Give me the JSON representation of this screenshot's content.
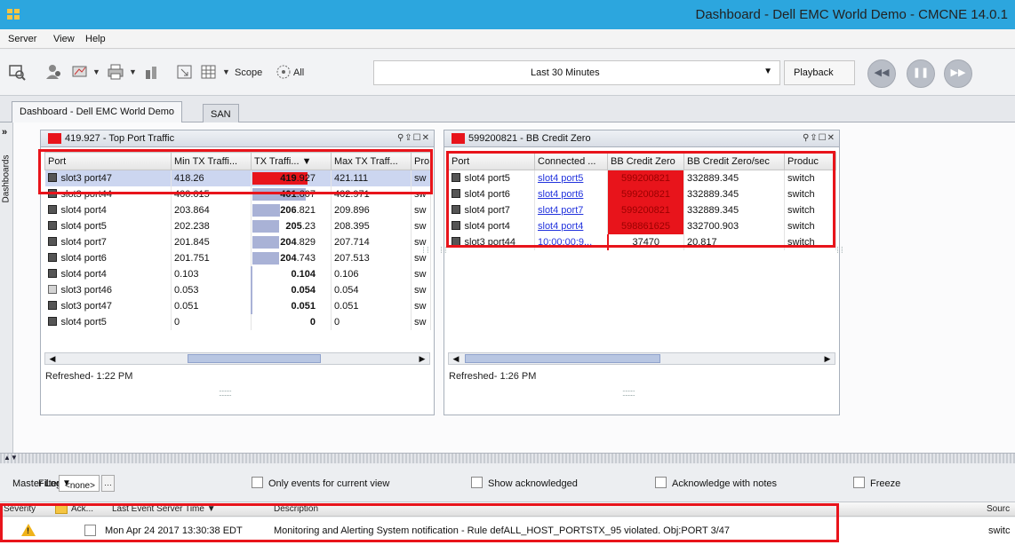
{
  "window": {
    "title": "Dashboard - Dell EMC World Demo - CMCNE 14.0.1"
  },
  "menu": {
    "server": "Server",
    "view": "View",
    "help": "Help"
  },
  "toolbar": {
    "scope_label": "Scope",
    "scope_value": "All",
    "time_range": "Last 30 Minutes",
    "playback_label": "Playback",
    "icons": [
      "discover-icon",
      "users-icon",
      "monitor-icon",
      "print-icon",
      "reports-icon",
      "zoom-icon",
      "grid-icon",
      "scope-icon",
      "rewind-icon",
      "pause-icon",
      "fast-forward-icon"
    ]
  },
  "tabs": [
    {
      "label": "Dashboard - Dell EMC World Demo",
      "active": true
    },
    {
      "label": "SAN",
      "active": false
    }
  ],
  "siderail": {
    "label": "Dashboards"
  },
  "colors": {
    "accent_red": "#e8141b",
    "bar_blue": "#a9b2d6",
    "link_blue": "#2233dd",
    "titlebar": "#2ca6de"
  },
  "widget1": {
    "title": "419.927 - Top Port Traffic",
    "controls": "⚲⇪☐✕",
    "columns": [
      "Port",
      "Min TX Traffi...",
      "TX Traffi... ▼",
      "Max TX Traff...",
      "Pro"
    ],
    "rows": [
      {
        "port": "slot3 port47",
        "min": "418.26",
        "tx_int": "419",
        "tx_dec": ".927",
        "tx": 419.927,
        "max": "421.111",
        "prod": "sw",
        "selected": true,
        "red": true
      },
      {
        "port": "slot3 port44",
        "min": "400.015",
        "tx_int": "401",
        "tx_dec": ".607",
        "tx": 401.607,
        "max": "402.971",
        "prod": "sw"
      },
      {
        "port": "slot4 port4",
        "min": "203.864",
        "tx_int": "206",
        "tx_dec": ".821",
        "tx": 206.821,
        "max": "209.896",
        "prod": "sw"
      },
      {
        "port": "slot4 port5",
        "min": "202.238",
        "tx_int": "205",
        "tx_dec": ".23",
        "tx": 205.23,
        "max": "208.395",
        "prod": "sw"
      },
      {
        "port": "slot4 port7",
        "min": "201.845",
        "tx_int": "204",
        "tx_dec": ".829",
        "tx": 204.829,
        "max": "207.714",
        "prod": "sw"
      },
      {
        "port": "slot4 port6",
        "min": "201.751",
        "tx_int": "204",
        "tx_dec": ".743",
        "tx": 204.743,
        "max": "207.513",
        "prod": "sw"
      },
      {
        "port": "slot4 port4",
        "min": "0.103",
        "tx_int": "0.104",
        "tx_dec": "",
        "tx": 0.104,
        "max": "0.106",
        "prod": "sw"
      },
      {
        "port": "slot3 port46",
        "min": "0.053",
        "tx_int": "0.054",
        "tx_dec": "",
        "tx": 0.054,
        "max": "0.054",
        "prod": "sw",
        "light": true
      },
      {
        "port": "slot3 port47",
        "min": "0.051",
        "tx_int": "0.051",
        "tx_dec": "",
        "tx": 0.051,
        "max": "0.051",
        "prod": "sw"
      },
      {
        "port": "slot4 port5",
        "min": "0",
        "tx_int": "0",
        "tx_dec": "",
        "tx": 0,
        "max": "0",
        "prod": "sw"
      }
    ],
    "refreshed": "Refreshed- 1:22 PM"
  },
  "widget2": {
    "title": "599200821 - BB Credit Zero",
    "controls": "⚲⇪☐✕",
    "columns": [
      "Port",
      "Connected ...",
      "BB Credit Zero",
      "BB Credit Zero/sec",
      "Produc"
    ],
    "rows": [
      {
        "port": "slot4 port5",
        "connected": "slot4 port5",
        "bb": "599200821",
        "bbsec": "332889.345",
        "prod": "switch",
        "red": true
      },
      {
        "port": "slot4 port6",
        "connected": "slot4 port6",
        "bb": "599200821",
        "bbsec": "332889.345",
        "prod": "switch",
        "red": true
      },
      {
        "port": "slot4 port7",
        "connected": "slot4 port7",
        "bb": "599200821",
        "bbsec": "332889.345",
        "prod": "switch",
        "red": true
      },
      {
        "port": "slot4 port4",
        "connected": "slot4 port4",
        "bb": "598861625",
        "bbsec": "332700.903",
        "prod": "switch",
        "red": true
      },
      {
        "port": "slot3 port44",
        "connected": "10:00:00:9...",
        "bb": "37470",
        "bbsec": "20.817",
        "prod": "switch",
        "red": false
      }
    ],
    "refreshed": "Refreshed- 1:26 PM"
  },
  "masterlog": {
    "title": "Master Log",
    "filter_label": "Filter",
    "filter_value": "<none>",
    "options": [
      "Only events for current view",
      "Show acknowledged",
      "Acknowledge with notes",
      "Freeze"
    ],
    "columns": {
      "severity": "Severity",
      "ack": "Ack...",
      "time": "Last Event Server Time ▼",
      "description": "Description",
      "source": "Sourc"
    },
    "row": {
      "time": "Mon Apr 24 2017 13:30:38 EDT",
      "description": "Monitoring and Alerting System notification - Rule defALL_HOST_PORTSTX_95 violated. Obj:PORT 3/47",
      "source": "switc"
    }
  }
}
